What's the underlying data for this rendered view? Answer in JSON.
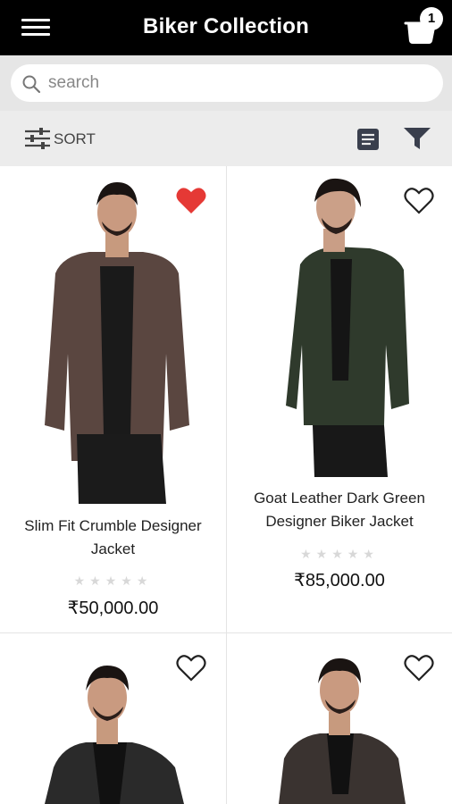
{
  "header": {
    "title": "Biker Collection",
    "cart_count": "1"
  },
  "search": {
    "placeholder": "search"
  },
  "toolbar": {
    "sort_label": "SORT"
  },
  "icons": {
    "menu": "menu-icon",
    "cart": "cart-icon",
    "search": "search-icon",
    "sort": "sliders-icon",
    "list_view": "list-view-icon",
    "filter": "filter-icon",
    "favorite": "heart-icon"
  },
  "colors": {
    "header_bg": "#000000",
    "favorite_active": "#e53935",
    "favorite_inactive": "#222222",
    "star_empty": "#d8d8d8"
  },
  "products": [
    {
      "name_line1": "Slim Fit Crumble Designer",
      "name_line2": "Jacket",
      "price": "₹50,000.00",
      "rating": 0,
      "favorited": true,
      "jacket_color": "#5a4640"
    },
    {
      "name_line1": "Goat Leather Dark Green",
      "name_line2": "Designer Biker Jacket",
      "price": "₹85,000.00",
      "rating": 0,
      "favorited": false,
      "jacket_color": "#2f3a2c"
    },
    {
      "name_line1": "",
      "name_line2": "",
      "price": "",
      "rating": 0,
      "favorited": false,
      "jacket_color": "#2a2a2a"
    },
    {
      "name_line1": "",
      "name_line2": "",
      "price": "",
      "rating": 0,
      "favorited": false,
      "jacket_color": "#3a3330"
    }
  ]
}
